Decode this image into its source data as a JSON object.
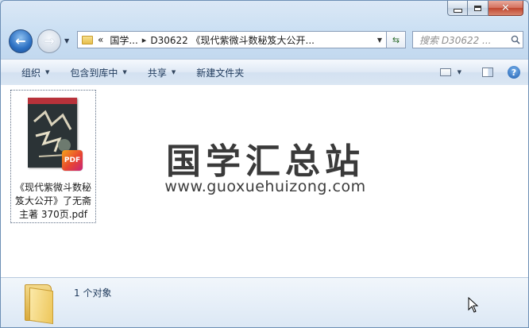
{
  "window": {
    "caption_buttons": [
      "minimize",
      "maximize",
      "close"
    ]
  },
  "nav": {
    "breadcrumb_prefix": "«",
    "breadcrumb_root": "国学...",
    "breadcrumb_arrow": "▸",
    "breadcrumb_current": "D30622 《现代紫微斗数秘笈大公开...",
    "search_placeholder": "搜索 D30622 ..."
  },
  "toolbar": {
    "items": [
      {
        "label": "组织",
        "has_dropdown": true
      },
      {
        "label": "包含到库中",
        "has_dropdown": true
      },
      {
        "label": "共享",
        "has_dropdown": true
      },
      {
        "label": "新建文件夹",
        "has_dropdown": false
      }
    ]
  },
  "files": [
    {
      "name": "《现代紫微斗数秘笈大公开》了无斋主著 370页.pdf",
      "type": "pdf",
      "badge": "PDF"
    }
  ],
  "watermark": {
    "title": "国学汇总站",
    "url": "www.guoxuehuizong.com"
  },
  "details": {
    "count_text": "1 个对象"
  },
  "colors": {
    "accent": "#1e395b",
    "close_button": "#c0462f",
    "window_border": "#6d8fb5"
  }
}
